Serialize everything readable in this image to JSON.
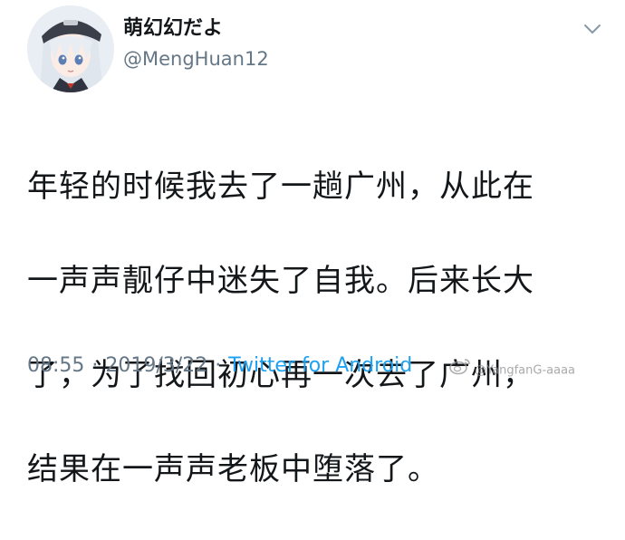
{
  "user": {
    "display_name": "萌幻幻だよ",
    "handle": "@MengHuan12"
  },
  "tweet": {
    "text_lines": [
      "年轻的时候我去了一趟广州，从此在",
      "一声声靓仔中迷失了自我。后来长大",
      "了，为了找回初心再一次去了广州，",
      "结果在一声声老板中堕落了。"
    ]
  },
  "footer": {
    "time": "08:55",
    "separator": "·",
    "date": "2019/3/22",
    "source": "Twitter for Android"
  },
  "watermark": {
    "text": "@YangfanG-aaaa",
    "icon": "weibo-logo-icon"
  },
  "icons": {
    "menu": "chevron-down-icon",
    "avatar": "anime-girl-avatar"
  },
  "colors": {
    "text_primary": "#14171a",
    "text_secondary": "#657786",
    "link": "#1da1f2",
    "background": "#ffffff"
  }
}
